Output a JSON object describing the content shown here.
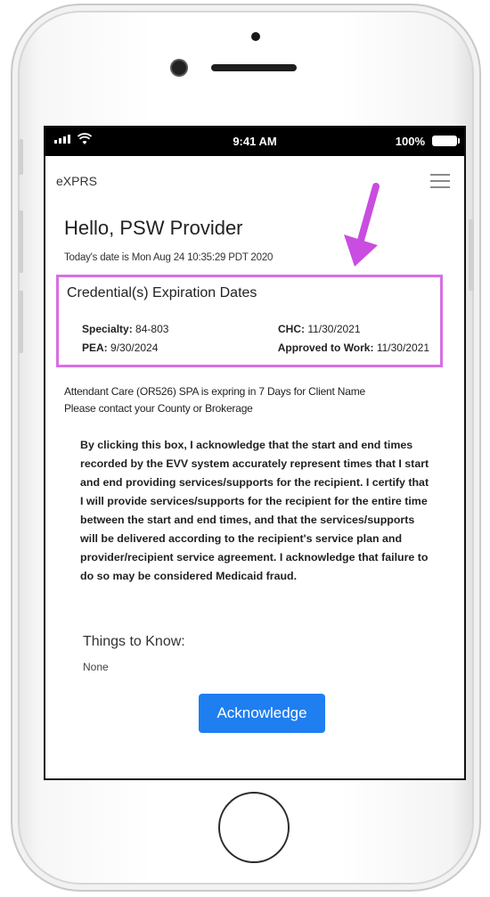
{
  "status_bar": {
    "time": "9:41 AM",
    "battery": "100%"
  },
  "app": {
    "brand": "eXPRS",
    "greeting": "Hello, PSW Provider",
    "date_line": "Today's date is Mon Aug 24 10:35:29 PDT 2020"
  },
  "credentials": {
    "title": "Credential(s) Expiration Dates",
    "items": [
      {
        "label": "Specialty:",
        "value": "84-803"
      },
      {
        "label": "PEA:",
        "value": "9/30/2024"
      },
      {
        "label": "CHC:",
        "value": "11/30/2021"
      },
      {
        "label": "Approved to Work:",
        "value": "11/30/2021"
      }
    ]
  },
  "notice": {
    "line1": "Attendant Care (OR526) SPA is expring in 7 Days for Client Name",
    "line2": "Please contact your County or Brokerage"
  },
  "acknowledgement": {
    "text": "By clicking this box, I acknowledge that the start and end times recorded by the EVV system accurately represent times that I start and end providing services/supports for the recipient. I certify that I will provide services/supports for the recipient for the entire time between the start and end times, and that the services/supports will be delivered according to the recipient's service plan and provider/recipient service agreement. I acknowledge that failure to do so may be considered Medicaid fraud.",
    "button_label": "Acknowledge"
  },
  "things_to_know": {
    "title": "Things to Know:",
    "value": "None"
  },
  "colors": {
    "highlight": "#d86ee6",
    "button": "#1f7ef0",
    "arrow": "#c94de0"
  }
}
